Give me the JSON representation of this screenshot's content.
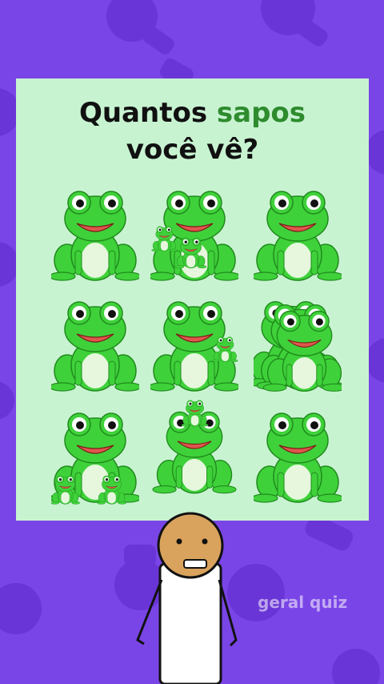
{
  "question": {
    "line1_prefix": "Quantos ",
    "line1_accent": "sapos",
    "line2": "você vê?"
  },
  "watermark": "geral quiz",
  "colors": {
    "background": "#7a45e6",
    "card": "#c8f3d1",
    "accent_text": "#2e8b2e",
    "frog_green": "#3fd13a",
    "frog_belly": "#e6f7dd"
  },
  "grid": {
    "rows": 3,
    "cols": 3,
    "cells": [
      {
        "frogs": "main"
      },
      {
        "frogs": "main-with-two-small"
      },
      {
        "frogs": "main"
      },
      {
        "frogs": "main"
      },
      {
        "frogs": "main-with-peeking"
      },
      {
        "frogs": "three-overlapping"
      },
      {
        "frogs": "main-with-two-small-bottom"
      },
      {
        "frogs": "main-with-small-on-head"
      },
      {
        "frogs": "main"
      }
    ]
  }
}
